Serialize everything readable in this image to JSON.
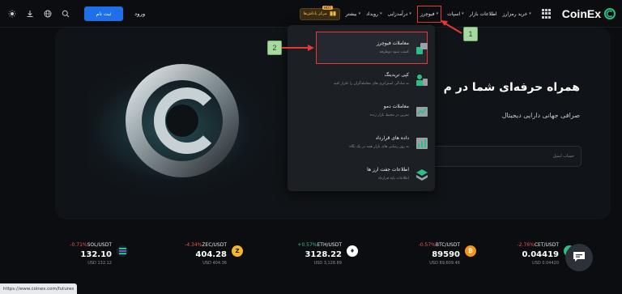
{
  "nav": {
    "logo_text": "CoinEx",
    "menu": [
      {
        "label": "خرید رمزارز",
        "has_chevron": true
      },
      {
        "label": "اطلاعات بازار",
        "has_chevron": false
      },
      {
        "label": "اسپات",
        "has_chevron": true
      },
      {
        "label": "فیوچرز",
        "has_chevron": true
      },
      {
        "label": "درآمدزایی",
        "has_chevron": true
      },
      {
        "label": "رویداد",
        "has_chevron": true
      },
      {
        "label": "بیشتر",
        "has_chevron": true
      }
    ],
    "hot_badge": "HOT",
    "reward_label": "مرکز پاداش‌ها",
    "login_label": "ورود",
    "signup_label": "ثبت نام",
    "icons": [
      "theme-icon",
      "download-icon",
      "globe-icon",
      "search-icon"
    ]
  },
  "hero": {
    "title": "همراه حرفه‌ای شما در م",
    "subtitle": "صرافی جهانی دارایی دیجیتال",
    "input_placeholder": "حساب ایمیل"
  },
  "dropdown": {
    "items": [
      {
        "title": "معاملات فیوچرز",
        "desc": "کسب سود دوطرفه",
        "icon": "futures-icon"
      },
      {
        "title": "کپی تریدینگ",
        "desc": "به سادگی استراتژی های معامله‌گران را تکرار کنید",
        "icon": "copy-trading-icon"
      },
      {
        "title": "معاملات دمو",
        "desc": "تمرین در محیط بازار زنده",
        "icon": "demo-trading-icon"
      },
      {
        "title": "داده های قرارداد",
        "desc": "به روز رسانی های بازار همه در یک نگاه",
        "icon": "contract-data-icon"
      },
      {
        "title": "اطلاعات جفت ارز ها",
        "desc": "اطلاعات پایه قرارداد",
        "icon": "pair-info-icon"
      }
    ]
  },
  "callouts": [
    "1",
    "2"
  ],
  "ticker": [
    {
      "pair": "CET/USDT",
      "change": "-2.76%",
      "dir": "neg",
      "price": "0.04419",
      "usd": "USD 0.04420",
      "coin_icon": "coinex-coin-icon",
      "color": "#2ebd85"
    },
    {
      "pair": "BTC/USDT",
      "change": "-0.57%",
      "dir": "neg",
      "price": "89590",
      "usd": "USD 89,609.46",
      "coin_icon": "bitcoin-icon",
      "color": "#f7931a"
    },
    {
      "pair": "ETH/USDT",
      "change": "+0.57%",
      "dir": "pos",
      "price": "3128.22",
      "usd": "USD 3,128.89",
      "coin_icon": "ethereum-icon",
      "color": "#ffffff"
    },
    {
      "pair": "ZEC/USDT",
      "change": "-4.34%",
      "dir": "neg",
      "price": "404.28",
      "usd": "USD 404.36",
      "coin_icon": "zcash-icon",
      "color": "#f4b728"
    },
    {
      "pair": "SOL/USDT",
      "change": "-0.71%",
      "dir": "neg",
      "price": "132.10",
      "usd": "USD 132.12",
      "coin_icon": "solana-icon",
      "color": "#1e1f2e"
    }
  ],
  "status_url": "https://www.coinex.com/futures"
}
